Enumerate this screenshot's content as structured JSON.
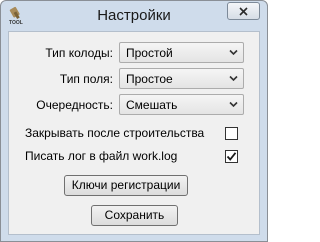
{
  "window": {
    "title": "Настройки"
  },
  "fields": [
    {
      "label": "Тип колоды:",
      "value": "Простой"
    },
    {
      "label": "Тип поля:",
      "value": "Простое"
    },
    {
      "label": "Очередность:",
      "value": "Смешать"
    }
  ],
  "options": [
    {
      "label": "Закрывать после строительства",
      "checked": false
    },
    {
      "label": "Писать лог в файл work.log",
      "checked": true
    }
  ],
  "buttons": {
    "registration_keys": "Ключи регистрации",
    "save": "Сохранить"
  },
  "icons": {
    "app": "tool-app-icon",
    "close": "close-icon",
    "dropdown": "chevron-down-icon",
    "check": "checkmark-icon"
  },
  "app_icon_text": "TOOL"
}
